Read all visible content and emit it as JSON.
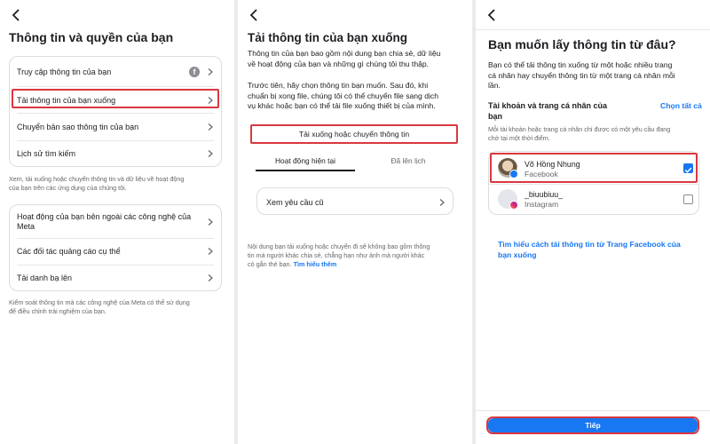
{
  "colors": {
    "accent": "#1877f2",
    "highlight": "#d9383f",
    "muted": "#65676b"
  },
  "panel1": {
    "title": "Thông tin và quyền của bạn",
    "group1": [
      {
        "label": "Truy cập thông tin của bạn",
        "icon": "facebook-icon"
      },
      {
        "label": "Tải thông tin của bạn xuống"
      },
      {
        "label": "Chuyển bản sao thông tin của bạn"
      },
      {
        "label": "Lịch sử tìm kiếm"
      }
    ],
    "note1_line1": "Xem, tải xuống hoặc chuyển thông tin và dữ liệu về hoạt động",
    "note1_line2": "của bạn trên các ứng dụng của chúng tôi.",
    "group2": [
      {
        "line1": "Hoạt động của bạn bên ngoài các công nghệ của",
        "line2": "Meta"
      },
      {
        "line1": "Các đối tác quảng cáo cụ thể"
      },
      {
        "line1": "Tải danh bạ lên"
      }
    ],
    "note2_line1": "Kiểm soát thông tin mà các công nghệ của Meta có thể sử dụng",
    "note2_line2": "để điều chỉnh trải nghiệm của bạn."
  },
  "panel2": {
    "title": "Tải thông tin của bạn xuống",
    "para1_line1": "Thông tin của bạn bao gồm nội dung bạn chia sẻ, dữ liệu",
    "para1_line2": "về hoạt động của bạn và những gì chúng tôi thu thập.",
    "para2_line1": "Trước tiên, hãy chọn thông tin bạn muốn. Sau đó, khi",
    "para2_line2": "chuẩn bị xong file, chúng tôi có thể chuyển file sang dịch",
    "para2_line3": "vụ khác hoặc bạn có thể tải file xuống thiết bị của mình.",
    "action_button": "Tải xuống hoặc chuyển thông tin",
    "tab_current": "Hoạt động hiện tại",
    "tab_done": "Đã lên lịch",
    "old_requests": "Xem yêu cầu cũ",
    "footer_line1": "Nội dung bạn tải xuống hoặc chuyển đi sẽ không bao gồm thông",
    "footer_line2": "tin mà người khác chia sẻ, chẳng hạn như ảnh mà người khác",
    "footer_line3": "có gắn thẻ bạn.",
    "footer_link": "Tìm hiểu thêm"
  },
  "panel3": {
    "title": "Bạn muốn lấy thông tin từ đâu?",
    "intro_line1": "Bạn có thể tải thông tin xuống từ một hoặc nhiều trang",
    "intro_line2": "cá nhân hay chuyển thông tin từ một trang cá nhân mỗi",
    "intro_line3": "lần.",
    "section_label_line1": "Tài khoản và trang cá nhân của",
    "section_label_line2": "bạn",
    "select_all": "Chọn tất cả",
    "section_note_line1": "Mỗi tài khoản hoặc trang cá nhân chỉ được có một yêu cầu đang",
    "section_note_line2": "chờ tại một thời điểm.",
    "accounts": [
      {
        "name": "Võ Hồng Nhung",
        "platform": "Facebook",
        "checked": true
      },
      {
        "name": "_biuubiuu_",
        "platform": "Instagram",
        "checked": false
      }
    ],
    "learn_link_line1": "Tìm hiểu cách tải thông tin từ Trang Facebook của",
    "learn_link_line2": "bạn xuống",
    "next_button": "Tiếp"
  }
}
